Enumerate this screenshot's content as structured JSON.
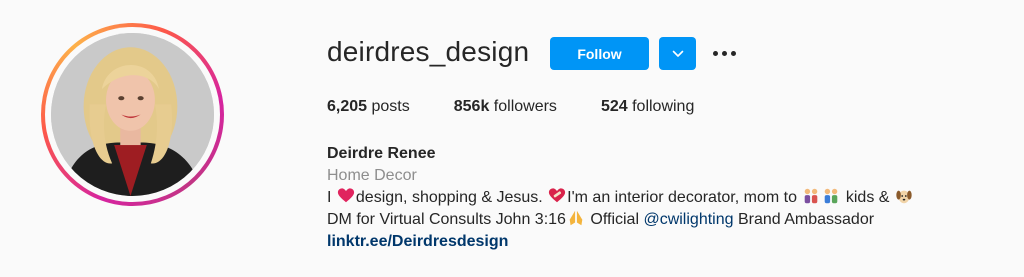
{
  "profile": {
    "username": "deirdres_design",
    "buttons": {
      "follow_label": "Follow"
    },
    "stats": {
      "posts_count": "6,205",
      "posts_label": "posts",
      "followers_count": "856k",
      "followers_label": "followers",
      "following_count": "524",
      "following_label": "following"
    },
    "bio": {
      "full_name": "Deirdre Renee",
      "category": "Home Decor",
      "line1_a": "I",
      "line1_b": "design, shopping & Jesus.",
      "line1_c": "I'm an interior decorator, mom to",
      "line1_d": "kids &",
      "line2_a": "DM for Virtual Consults John 3:16",
      "line2_b": "Official",
      "mention": "@cwilighting",
      "line2_c": "Brand Ambassador",
      "link": "linktr.ee/Deirdresdesign"
    },
    "icons": [
      "red-heart-icon",
      "mending-heart-icon",
      "family-icon",
      "family-icon",
      "dog-face-icon",
      "praying-hands-icon",
      "chevron-down-icon",
      "more-options-icon"
    ],
    "colors": {
      "accent": "#0095f6",
      "link": "#00376b",
      "muted": "#8e8e8e",
      "text": "#262626",
      "background": "#fafafa"
    }
  }
}
